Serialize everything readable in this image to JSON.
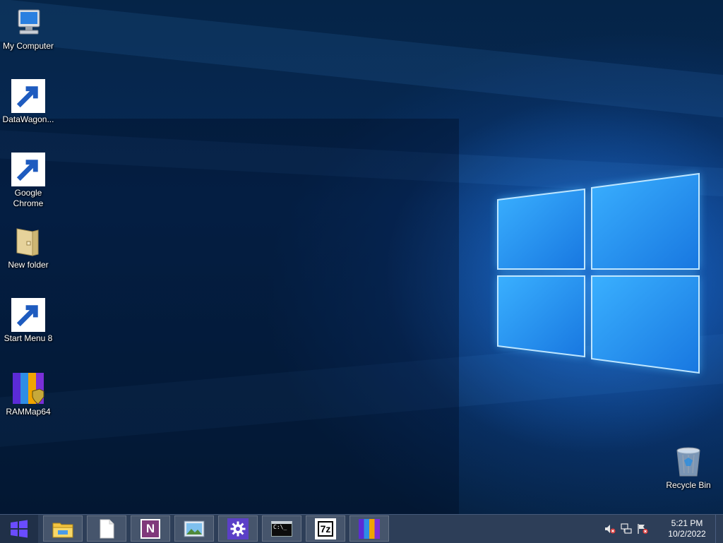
{
  "desktop": {
    "icons": [
      {
        "label": "My Computer",
        "icon": "my-computer-icon"
      },
      {
        "label": "DataWagon...",
        "icon": "datawagon-icon"
      },
      {
        "label": "Google Chrome",
        "icon": "google-chrome-icon"
      },
      {
        "label": "New folder",
        "icon": "folder-icon"
      },
      {
        "label": "Start Menu 8",
        "icon": "start-menu-8-icon"
      },
      {
        "label": "RAMMap64",
        "icon": "rammap-icon"
      }
    ],
    "recycle_bin": {
      "label": "Recycle Bin",
      "icon": "recycle-bin-icon"
    }
  },
  "taskbar": {
    "start": {
      "icon": "windows-logo-icon"
    },
    "pinned": [
      {
        "name": "file-explorer",
        "icon": "file-explorer-icon"
      },
      {
        "name": "blank-document",
        "icon": "document-icon"
      },
      {
        "name": "onenote",
        "icon": "onenote-icon",
        "text": "N"
      },
      {
        "name": "photo-viewer",
        "icon": "photo-viewer-icon"
      },
      {
        "name": "settings",
        "icon": "gear-icon"
      },
      {
        "name": "command-prompt",
        "icon": "command-prompt-icon",
        "text": "C:\\_"
      },
      {
        "name": "7zip",
        "icon": "7zip-icon",
        "text": "7z"
      },
      {
        "name": "rammap",
        "icon": "rammap-icon"
      }
    ],
    "tray": {
      "icons": [
        "volume-muted-icon",
        "network-icon",
        "action-center-flag-icon"
      ],
      "time": "5:21 PM",
      "date": "10/2/2022"
    }
  },
  "colors": {
    "taskbar": "#2d3e58",
    "wallpaper_dark": "#06203f",
    "wallpaper_glow": "#2a9cff",
    "start_logo": "#6a4cff"
  }
}
